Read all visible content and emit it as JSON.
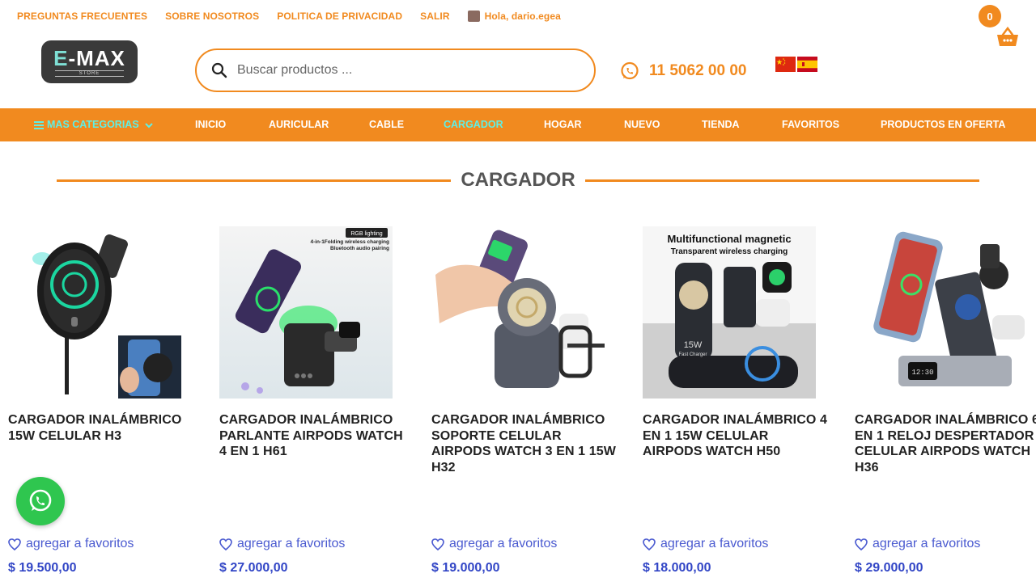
{
  "top_links": [
    "PREGUNTAS FRECUENTES",
    "SOBRE NOSOTROS",
    "POLITICA DE PRIVACIDAD",
    "SALIR"
  ],
  "user_greeting": "Hola, dario.egea",
  "cart_count": "0",
  "logo": {
    "text_e": "E",
    "text_rest": "-MAX",
    "sub": "STORE"
  },
  "search": {
    "placeholder": "Buscar productos ..."
  },
  "phone": "11 5062 00 00",
  "languages": [
    "chinese-flag",
    "spanish-flag"
  ],
  "nav": {
    "categories_label": "MAS CATEGORIAS",
    "items": [
      "INICIO",
      "AURICULAR",
      "CABLE",
      "CARGADOR",
      "HOGAR",
      "NUEVO",
      "TIENDA",
      "FAVORITOS",
      "PRODUCTOS EN OFERTA"
    ],
    "active": "CARGADOR"
  },
  "section_title": "CARGADOR",
  "favorite_label": "agregar a favoritos",
  "products": [
    {
      "title": "CARGADOR INALÁMBRICO 15W CELULAR H3",
      "price": "$ 19.500,00"
    },
    {
      "title": "CARGADOR INALÁMBRICO PARLANTE AIRPODS WATCH 4 EN 1 H61",
      "price": "$ 27.000,00",
      "img_text": [
        "RGB lighting",
        "4-in-1Folding wireless charging",
        "Bluetooth audio pairing"
      ]
    },
    {
      "title": "CARGADOR INALÁMBRICO SOPORTE CELULAR AIRPODS WATCH 3 EN 1 15W H32",
      "price": "$ 19.000,00"
    },
    {
      "title": "CARGADOR INALÁMBRICO 4 EN 1 15W CELULAR AIRPODS WATCH H50",
      "price": "$ 18.000,00",
      "img_text": [
        "Multifunctional magnetic",
        "Transparent wireless charging",
        "15W",
        "Fast Charger"
      ]
    },
    {
      "title": "CARGADOR INALÁMBRICO 6 EN 1 RELOJ DESPERTADOR CELULAR AIRPODS WATCH H36",
      "price": "$ 29.000,00",
      "img_text": [
        "12:30"
      ]
    }
  ],
  "colors": {
    "accent": "#f18a1f",
    "active_nav": "#5ef0e6",
    "price": "#3246c6",
    "whatsapp": "#2fc64f"
  }
}
